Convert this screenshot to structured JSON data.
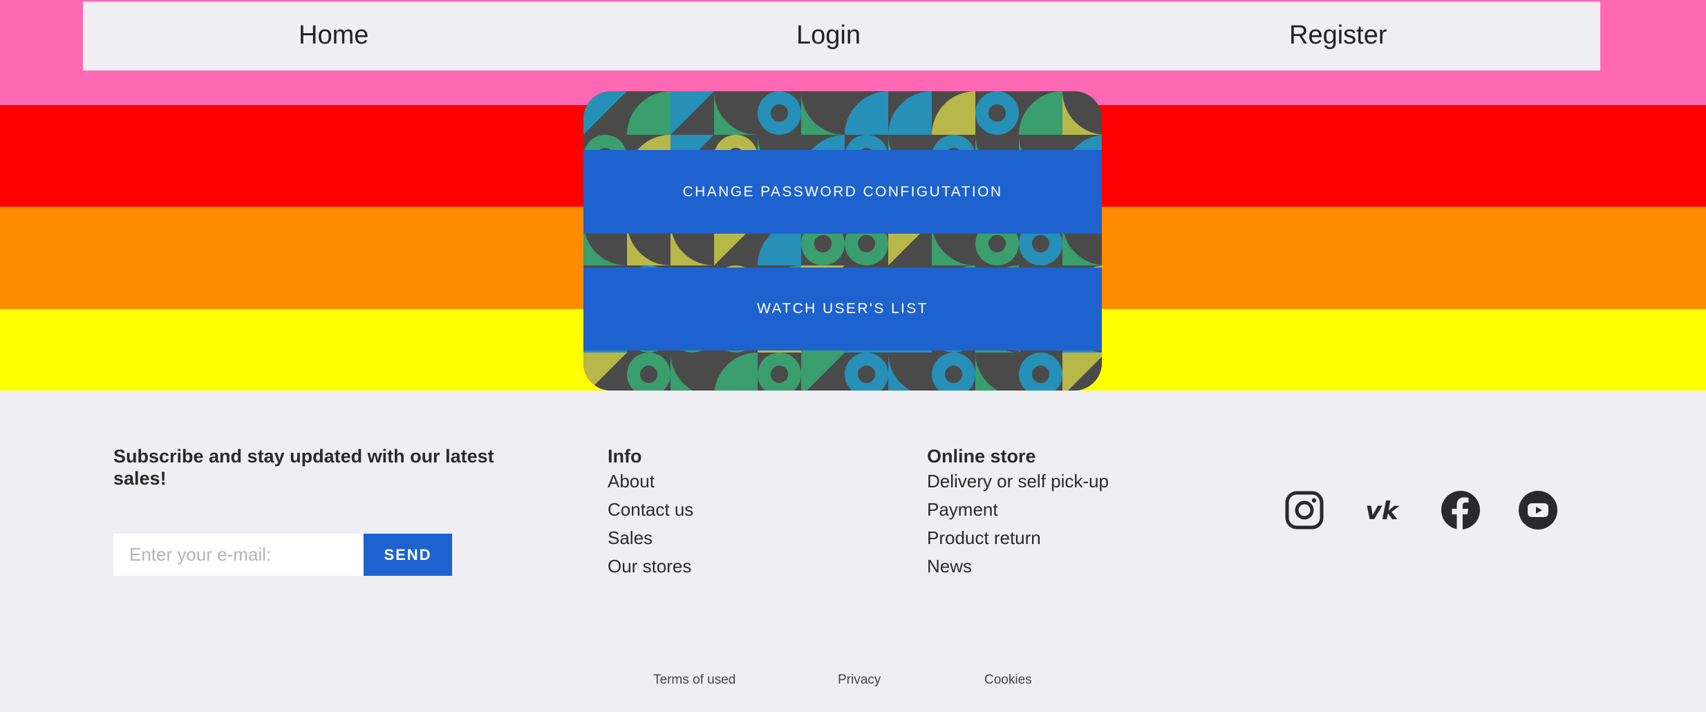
{
  "nav": {
    "home": "Home",
    "login": "Login",
    "register": "Register"
  },
  "stripe_colors": [
    "#ff69b4",
    "#ff0000",
    "#ff8c00",
    "#ffff00"
  ],
  "card": {
    "change_password": "CHANGE PASSWORD CONFIGUTATION",
    "watch_users": "WATCH USER'S LIST",
    "button_color": "#1e62cf",
    "pattern_colors": [
      "#3a9e6e",
      "#2690b8",
      "#b8b84a",
      "#4a4a4a"
    ]
  },
  "footer": {
    "subscribe_heading": "Subscribe and stay updated with our latest sales!",
    "email_placeholder": "Enter your e-mail:",
    "send_label": "SEND",
    "info": {
      "heading": "Info",
      "items": [
        "About",
        "Contact us",
        "Sales",
        "Our stores"
      ]
    },
    "store": {
      "heading": "Online store",
      "items": [
        "Delivery or self pick-up",
        "Payment",
        "Product return",
        "News"
      ]
    },
    "social_icons": [
      "instagram-icon",
      "vk-icon",
      "facebook-icon",
      "youtube-icon"
    ],
    "legal": {
      "terms": "Terms of used",
      "privacy": "Privacy",
      "cookies": "Cookies"
    }
  }
}
